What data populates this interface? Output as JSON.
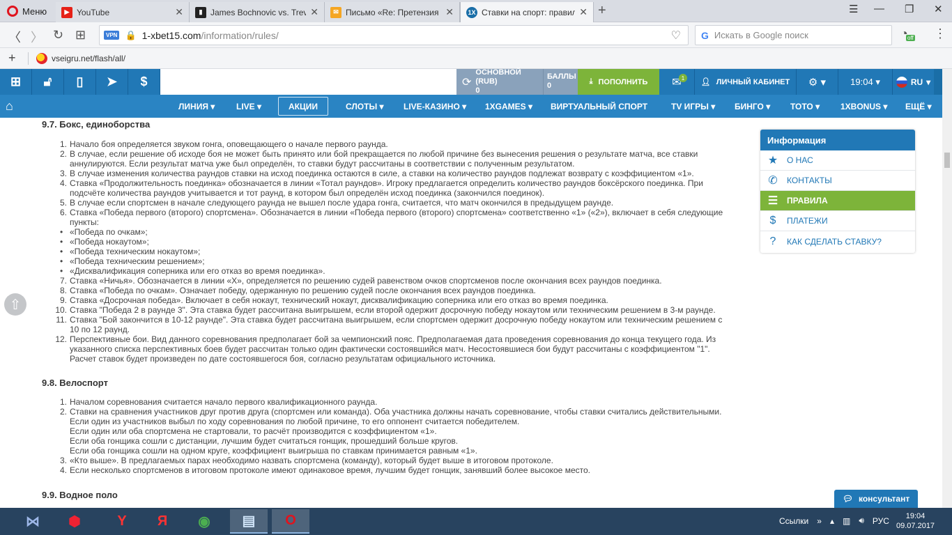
{
  "browser": {
    "menu_label": "Меню",
    "tabs": [
      {
        "title": "YouTube"
      },
      {
        "title": "James Bochnovic vs. Trevi"
      },
      {
        "title": "Письмо «Re: Претензия н"
      },
      {
        "title": "Ставки на спорт: правила"
      }
    ],
    "url_host": "1-xbet15.com",
    "url_path": "/information/rules/",
    "vpn_badge": "VPN",
    "search_placeholder": "Искать в Google поиск",
    "turbo_badge": "off",
    "bookmark": "vseigru.net/flash/all/"
  },
  "site": {
    "balance_label": "ОСНОВНОЙ (RUB)",
    "balance_value": "0",
    "points_label": "БАЛЛЫ",
    "points_value": "0",
    "deposit_label": "ПОПОЛНИТЬ",
    "mail_count": "1",
    "cabinet_label": "ЛИЧНЫЙ КАБИНЕТ",
    "time": "19:04",
    "lang": "RU",
    "nav": [
      "ЛИНИЯ",
      "LIVE",
      "АКЦИИ",
      "СЛОТЫ",
      "LIVE-КАЗИНО",
      "1XGAMES",
      "ВИРТУАЛЬНЫЙ СПОРТ",
      "TV ИГРЫ",
      "БИНГО",
      "ТОТО",
      "1XBONUS",
      "ЕЩЁ"
    ]
  },
  "sidebar": {
    "title": "Информация",
    "items": [
      "О НАС",
      "КОНТАКТЫ",
      "ПРАВИЛА",
      "ПЛАТЕЖИ",
      "КАК СДЕЛАТЬ СТАВКУ?"
    ]
  },
  "content": {
    "box_title": "9.7. Бокс, единоборства",
    "box_items": [
      {
        "n": "1.",
        "t": "Начало боя определяется звуком гонга, оповещающего о начале первого раунда."
      },
      {
        "n": "2.",
        "t": "В случае, если решение об исходе боя не может быть принято или бой прекращается по любой причине без вынесения решения о результате матча, все ставки"
      },
      {
        "n": "",
        "t": "аннулируются. Если результат матча уже был определён, то ставки будут рассчитаны в соответствии с полученным результатом."
      },
      {
        "n": "3.",
        "t": "В случае изменения количества раундов ставки на исход поединка остаются в силе, а ставки на количество раундов подлежат возврату с коэффициентом «1»."
      },
      {
        "n": "4.",
        "t": "Ставка «Продолжительность поединка» обозначается в линии «Тотал раундов». Игроку предлагается определить количество раундов боксёрского поединка. При"
      },
      {
        "n": "",
        "t": "подсчёте количества раундов учитывается и тот раунд, в котором был определён исход поединка (закончился поединок)."
      },
      {
        "n": "5.",
        "t": "В случае если спортсмен в начале следующего раунда не вышел после удара гонга, считается, что матч окончился в предыдущем раунде."
      },
      {
        "n": "6.",
        "t": "Ставка «Победа первого (второго) спортсмена». Обозначается в линии «Победа первого (второго) спортсмена» соответственно «1» («2»), включает в себя следующие"
      },
      {
        "n": "",
        "t": "пункты:"
      },
      {
        "n": "•",
        "t": "«Победа по очкам»;",
        "b": true
      },
      {
        "n": "•",
        "t": "«Победа нокаутом»;",
        "b": true
      },
      {
        "n": "•",
        "t": "«Победа техническим нокаутом»;",
        "b": true
      },
      {
        "n": "•",
        "t": "«Победа техническим решением»;",
        "b": true
      },
      {
        "n": "•",
        "t": "«Дисквалификация соперника или его отказ во время поединка».",
        "b": true
      },
      {
        "n": "7.",
        "t": "Ставка «Ничья». Обозначается в линии «Х», определяется по решению судей равенством очков спортсменов после окончания всех раундов поединка."
      },
      {
        "n": "8.",
        "t": "Ставка «Победа по очкам». Означает победу, одержанную по решению судей после окончания всех раундов поединка."
      },
      {
        "n": "9.",
        "t": "Ставка «Досрочная победа». Включает в себя нокаут, технический нокаут, дисквалификацию соперника или его отказ во время поединка."
      },
      {
        "n": "10.",
        "t": "Ставка \"Победа 2 в раунде 3\". Эта ставка будет рассчитана выигрышем, если второй одержит досрочную победу нокаутом или техническим решением в 3-м раунде."
      },
      {
        "n": "11.",
        "t": "Ставка \"Бой закончится в 10-12 раунде\". Эта ставка будет рассчитана выигрышем, если спортсмен одержит досрочную победу нокаутом или техническим решением с"
      },
      {
        "n": "",
        "t": "10 по 12 раунд."
      },
      {
        "n": "12.",
        "t": "Перспективные бои. Вид данного соревнования предполагает бой за чемпионский пояс. Предполагаемая дата проведения соревнования до конца текущего года. Из"
      },
      {
        "n": "",
        "t": "указанного списка перспективных боев будет рассчитан только один фактически состоявшийся матч. Несостоявшиеся бои будут рассчитаны с коэффициентом \"1\"."
      },
      {
        "n": "",
        "t": "Расчет ставок будет произведен по дате состоявшегося боя, согласно результатам официального источника."
      }
    ],
    "cycle_title": "9.8. Велоспорт",
    "cycle_items": [
      {
        "n": "1.",
        "t": "Началом соревнования считается начало первого квалификационного раунда."
      },
      {
        "n": "2.",
        "t": "Ставки на сравнения участников друг против друга (спортсмен или команда). Оба участника должны начать соревнование, чтобы ставки считались действительными."
      },
      {
        "n": "",
        "t": "Если один из участников выбыл по ходу соревнования по любой причине, то его оппонент считается победителем."
      },
      {
        "n": "",
        "t": "Если один или оба спортсмена не стартовали, то расчёт производится с коэффициентом «1»."
      },
      {
        "n": "",
        "t": "Если оба гонщика сошли с дистанции, лучшим будет считаться гонщик, прошедший больше кругов."
      },
      {
        "n": "",
        "t": "Если оба гонщика сошли на одном круге, коэффициент выигрыша по ставкам принимается равным «1»."
      },
      {
        "n": "3.",
        "t": "«Кто выше». В предлагаемых парах необходимо назвать спортсмена (команду), который будет выше в итоговом протоколе."
      },
      {
        "n": "4.",
        "t": "Если несколько спортсменов в итоговом протоколе имеют одинаковое время, лучшим будет гонщик, занявший более высокое место."
      }
    ],
    "water_title": "9.9. Водное поло"
  },
  "consultant": "консультант",
  "taskbar": {
    "tray_links": "Ссылки",
    "lang": "РУС",
    "time": "19:04",
    "date": "09.07.2017"
  },
  "colors": {
    "nav_blue": "#1a6ea7",
    "menu_blue": "#2a84c3",
    "green": "#7db43a"
  }
}
